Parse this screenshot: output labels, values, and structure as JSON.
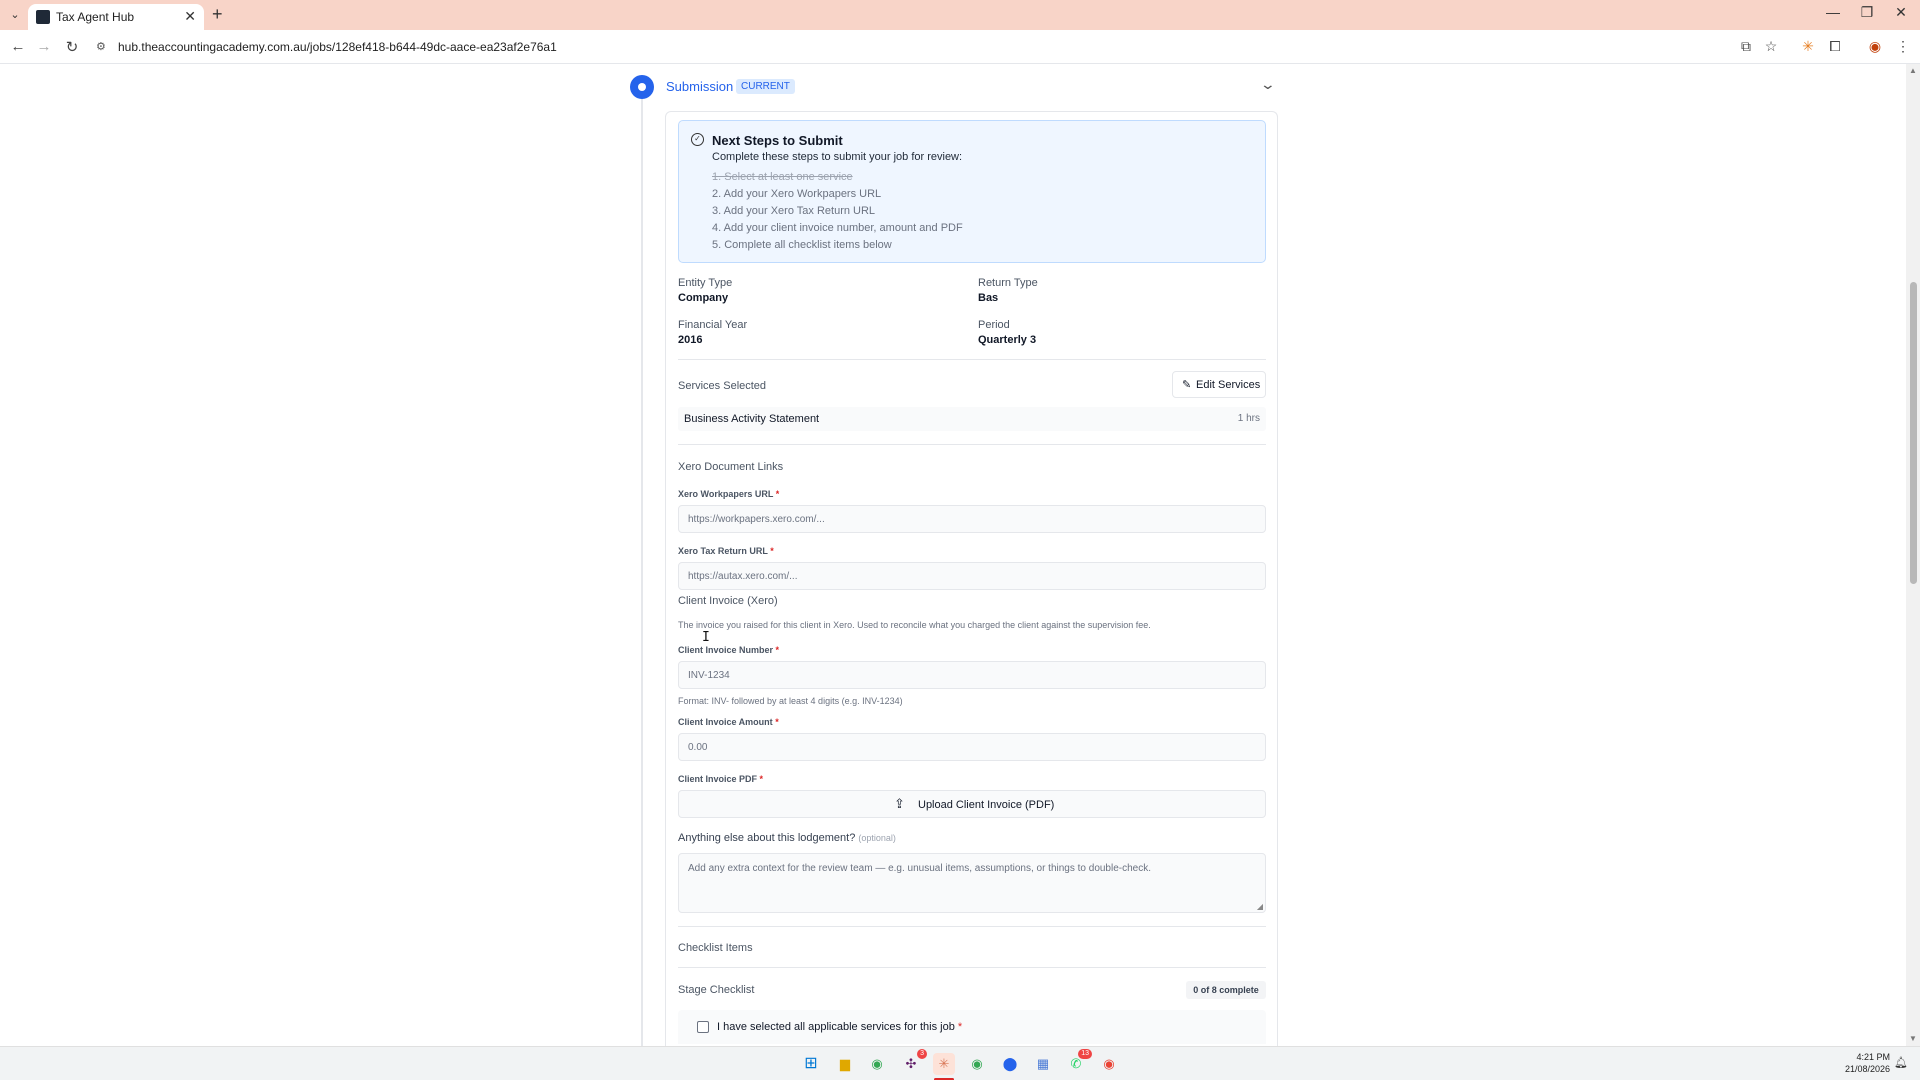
{
  "browser": {
    "tab_title": "Tax Agent Hub",
    "url": "hub.theaccountingacademy.com.au/jobs/128ef418-b644-49dc-aace-ea23af2e76a1"
  },
  "step": {
    "title": "Submission",
    "badge": "CURRENT"
  },
  "next_steps": {
    "title": "Next Steps to Submit",
    "intro": "Complete these steps to submit your job for review:",
    "items": [
      {
        "text": "1. Select at least one service",
        "done": true
      },
      {
        "text": "2. Add your Xero Workpapers URL",
        "done": false
      },
      {
        "text": "3. Add your Xero Tax Return URL",
        "done": false
      },
      {
        "text": "4. Add your client invoice number, amount and PDF",
        "done": false
      },
      {
        "text": "5. Complete all checklist items below",
        "done": false
      }
    ]
  },
  "details": {
    "entity_type_label": "Entity Type",
    "entity_type": "Company",
    "return_type_label": "Return Type",
    "return_type": "Bas",
    "financial_year_label": "Financial Year",
    "financial_year": "2016",
    "period_label": "Period",
    "period": "Quarterly 3"
  },
  "services": {
    "label": "Services Selected",
    "edit_button": "Edit Services",
    "items": [
      {
        "name": "Business Activity Statement",
        "hours": "1 hrs"
      }
    ]
  },
  "xero": {
    "section_label": "Xero Document Links",
    "workpapers_label": "Xero Workpapers URL",
    "workpapers_placeholder": "https://workpapers.xero.com/...",
    "tax_return_label": "Xero Tax Return URL",
    "tax_return_placeholder": "https://autax.xero.com/..."
  },
  "invoice": {
    "section_label": "Client Invoice (Xero)",
    "description": "The invoice you raised for this client in Xero. Used to reconcile what you charged the client against the supervision fee.",
    "number_label": "Client Invoice Number",
    "number_placeholder": "INV-1234",
    "number_help": "Format: INV- followed by at least 4 digits (e.g. INV-1234)",
    "amount_label": "Client Invoice Amount",
    "amount_placeholder": "0.00",
    "pdf_label": "Client Invoice PDF",
    "upload_button": "Upload Client Invoice (PDF)"
  },
  "notes": {
    "label": "Anything else about this lodgement?",
    "optional": "(optional)",
    "placeholder": "Add any extra context for the review team — e.g. unusual items, assumptions, or things to double-check."
  },
  "checklist": {
    "section_label": "Checklist Items",
    "stage_label": "Stage Checklist",
    "count": "0 of 8 complete",
    "items": [
      {
        "label": "I have selected all applicable services for this job",
        "checked": false
      }
    ]
  },
  "taskbar": {
    "time": "4:21 PM",
    "date": "21/08/2026",
    "badges": {
      "slack": "3",
      "whatsapp": "13"
    }
  }
}
